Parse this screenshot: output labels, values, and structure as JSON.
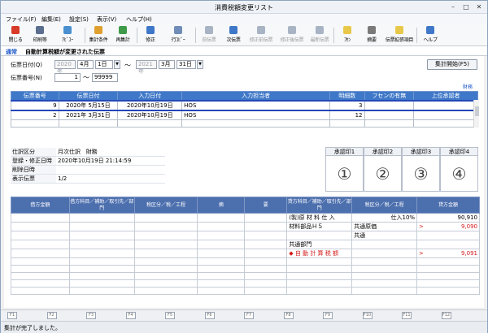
{
  "window": {
    "title": "消費税額変更リスト"
  },
  "menu": [
    "ファイル(F)",
    "編集(E)",
    "設定(S)",
    "表示(V)",
    "ヘルプ(H)"
  ],
  "toolbar": [
    {
      "label": "閉じる",
      "color": "#d83b2a",
      "disabled": false
    },
    {
      "label": "印刷等",
      "color": "#5a6f8f",
      "disabled": false
    },
    {
      "label": "ｱﾋﾞﾕｰ",
      "color": "#4a90d0",
      "disabled": false
    },
    {
      "label": "集計条件",
      "color": "#e0a030",
      "disabled": false
    },
    {
      "label": "再集計",
      "color": "#3f9a4a",
      "disabled": false
    },
    {
      "label": "修正",
      "color": "#3f78c8",
      "disabled": false
    },
    {
      "label": "行ｺﾋﾟｰ",
      "color": "#6f8db8",
      "disabled": false
    },
    {
      "label": "前伝票",
      "color": "#a8b4c4",
      "disabled": true
    },
    {
      "label": "次伝票",
      "color": "#3f78c8",
      "disabled": false
    },
    {
      "label": "修正前伝票",
      "color": "#a8b4c4",
      "disabled": true
    },
    {
      "label": "修正後伝票",
      "color": "#a8b4c4",
      "disabled": true
    },
    {
      "label": "最新伝票",
      "color": "#a8b4c4",
      "disabled": true
    },
    {
      "label": "ﾌｾﾝ",
      "color": "#e8c84a",
      "disabled": false
    },
    {
      "label": "摘要",
      "color": "#7a7a7a",
      "disabled": false
    },
    {
      "label": "伝票拡張項目",
      "color": "#e8c84a",
      "disabled": false
    },
    {
      "label": "ヘルプ",
      "color": "#3f78c8",
      "disabled": false
    }
  ],
  "tab": {
    "mode": "通常",
    "condition": "自動計算税額が変更された伝票"
  },
  "filter": {
    "date_label": "伝票日付(Q)",
    "date_from_year": "2020年",
    "date_from_month": "4月",
    "date_from_day": "1日",
    "tilde": "～",
    "date_to_year": "2021年",
    "date_to_month": "3月",
    "date_to_day": "31日",
    "number_label": "伝票番号(N)",
    "number_from": "1",
    "number_to": "99999",
    "button": "集計開始(F5)",
    "link": "財務"
  },
  "list": {
    "headers": [
      "伝票番号",
      "伝票日付",
      "入力日付",
      "入力担当者",
      "明細数",
      "フセンの有無",
      "上位承認者"
    ],
    "rows": [
      {
        "no": "9",
        "date": "2020年 5月15日",
        "input_date": "2020年10月19日",
        "user": "HOS",
        "count": "3",
        "fusen": "",
        "approver": ""
      },
      {
        "no": "2",
        "date": "2021年 3月31日",
        "input_date": "2020年10月19日",
        "user": "HOS",
        "count": "12",
        "fusen": "",
        "approver": ""
      }
    ]
  },
  "info": [
    {
      "k": "仕訳区分",
      "v1": "月次仕訳",
      "v2": "財務"
    },
    {
      "k": "登録・修正日時",
      "v1": "2020年10月19日  21:14:59",
      "v2": ""
    },
    {
      "k": "削除日時",
      "v1": "",
      "v2": ""
    },
    {
      "k": "表示伝票",
      "v1": "1/2",
      "v2": ""
    }
  ],
  "stamps": [
    {
      "label": "承認印1",
      "num": "①"
    },
    {
      "label": "承認印2",
      "num": "②"
    },
    {
      "label": "承認印3",
      "num": "③"
    },
    {
      "label": "承認印4",
      "num": "④"
    }
  ],
  "journal": {
    "headers": [
      "借方金額",
      "借方科目／補助／取引先／部門",
      "税区分／税／工程",
      "摘",
      "要",
      "貸方科目／補助／取引先／部門",
      "税区分／税／工程",
      "貸方金額"
    ],
    "rows": [
      {
        "cr_account": "(製)原 材 料 仕 入",
        "cr_tax": "仕入10%",
        "cr_amount": "90,910",
        "red": false,
        "mark": ""
      },
      {
        "cr_account": "材料部品Ｈ５",
        "cr_tax": "共通原価",
        "cr_amount": "9,090",
        "red": true,
        "mark": ">"
      },
      {
        "cr_account": "",
        "cr_tax": "共通",
        "cr_amount": "",
        "red": false,
        "mark": ""
      },
      {
        "cr_account": "共通部門",
        "cr_tax": "",
        "cr_amount": "",
        "red": false,
        "mark": ""
      },
      {
        "cr_account": "◆ 自 動 計 算 税 額",
        "cr_tax": "",
        "cr_amount": "9,091",
        "red": true,
        "mark": ">"
      }
    ]
  },
  "fkeys": [
    "F1",
    "F2",
    "F3",
    "F4",
    "F5",
    "F6",
    "F7",
    "F8",
    "F9",
    "F10",
    "F11",
    "F12"
  ],
  "status": "集計が完了しました。"
}
